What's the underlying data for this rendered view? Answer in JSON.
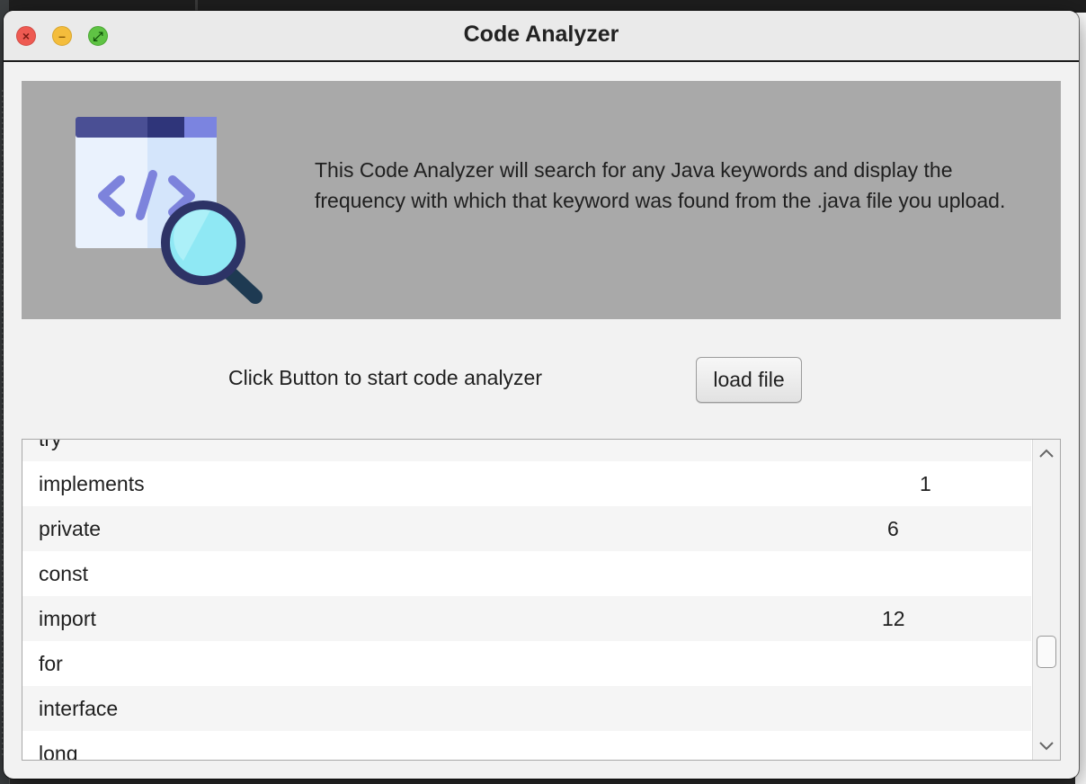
{
  "window": {
    "title": "Code Analyzer",
    "controls": {
      "close": "×",
      "minimize": "–",
      "maximize": "⤢"
    }
  },
  "banner": {
    "icon": "code-search-icon",
    "description": "This Code Analyzer will search for any Java keywords and display the frequency with which that keyword was found from the .java file you upload."
  },
  "action": {
    "prompt": "Click Button to start code analyzer",
    "button_label": "load file"
  },
  "keywords_list": {
    "rows": [
      {
        "keyword": "try",
        "count": ""
      },
      {
        "keyword": "implements",
        "count": "1"
      },
      {
        "keyword": "private",
        "count": "6"
      },
      {
        "keyword": "const",
        "count": ""
      },
      {
        "keyword": "import",
        "count": "12"
      },
      {
        "keyword": "for",
        "count": ""
      },
      {
        "keyword": "interface",
        "count": ""
      },
      {
        "keyword": "long",
        "count": ""
      }
    ],
    "scroll_position": 0.72
  },
  "colors": {
    "banner_bg": "#a9a9a9",
    "window_bg": "#f2f2f2",
    "row_alt": "#f5f5f5"
  }
}
